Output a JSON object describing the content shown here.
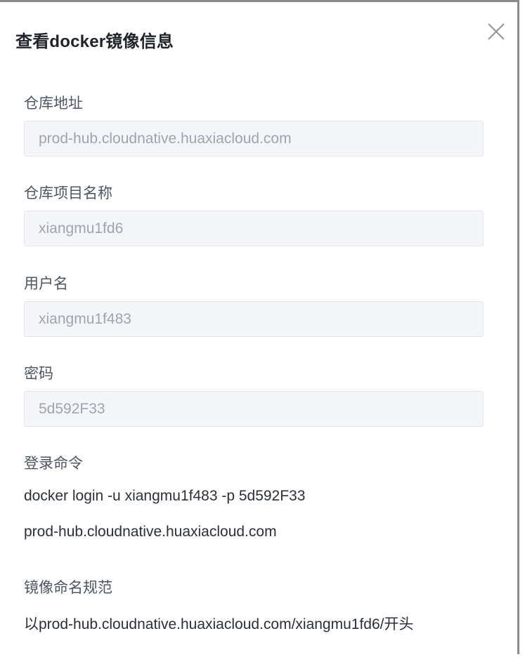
{
  "dialog": {
    "title": "查看docker镜像信息",
    "close_icon": "close-icon"
  },
  "fields": {
    "repo_address": {
      "label": "仓库地址",
      "value": "prod-hub.cloudnative.huaxiacloud.com"
    },
    "repo_project": {
      "label": "仓库项目名称",
      "value": "xiangmu1fd6"
    },
    "username": {
      "label": "用户名",
      "value": "xiangmu1f483"
    },
    "password": {
      "label": "密码",
      "value": "5d592F33"
    }
  },
  "login_command": {
    "label": "登录命令",
    "line1": "docker login -u xiangmu1f483 -p 5d592F33",
    "line2": "prod-hub.cloudnative.huaxiacloud.com"
  },
  "naming_rule": {
    "label": "镜像命名规范",
    "text": "以prod-hub.cloudnative.huaxiacloud.com/xiangmu1fd6/开头"
  },
  "colors": {
    "input_bg": "#f4f5f8",
    "input_text": "#9ea4ad",
    "label_text": "#4e5562",
    "title_text": "#1f2329"
  }
}
